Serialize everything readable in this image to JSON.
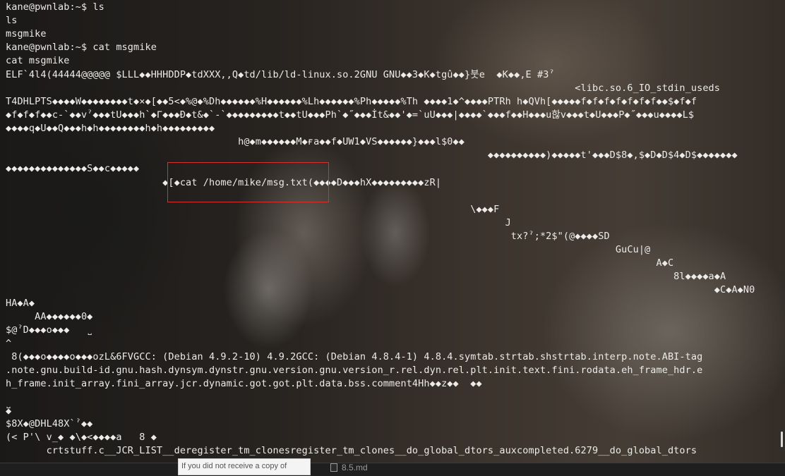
{
  "terminal": {
    "lines": [
      "kane@pwnlab:~$ ls",
      "ls",
      "msgmike",
      "kane@pwnlab:~$ cat msgmike",
      "cat msgmike",
      "ELF`4l4(44444@@@@@ $LLL◆◆HHHDDP◆tdXXX,,Q◆td/lib/ld-linux.so.2GNU GNU◆◆3◆K◆tgû◆◆}붓e  ◆K◆◆,E #3ˀ",
      "                                                                                                  <libc.so.6_IO_stdin_useds",
      "T4DHLPTS◆◆◆◆W◆◆◆◆◆◆◆◆t◆×◆[◆◆5<◆%@◆%Dh◆◆◆◆◆◆%H◆◆◆◆◆◆%Lh◆◆◆◆◆◆%Ph◆◆◆◆◆%Th ◆◆◆◆1◆^◆◆◆◆PTRh h◆QVh[◆◆◆◆◆f◆f◆f◆f◆f◆f◆f◆◆$◆f◆f",
      "◆f◆f◆f◆◆c-`◆◆vˀ◆◆◆tU◆◆◆h`◆Γ◆◆◆Đ◆t&◆`-`◆◆◆◆◆◆◆◆◆t◆◆tU◆◆◆Ph`◆˝◆◆◆İt&◆◆'◆=`uU◆◆◆|◆◆◆◆`◆◆◆f◆◆H◆◆◆u핞v◆◆◆t◆U◆◆◆P◆˝◆◆◆u◆◆◆◆L$",
      "◆◆◆◆q◆U◆◆Q◆◆◆h◆h◆◆◆◆◆◆◆◆h◆h◆◆◆◆◆◆◆◆◆",
      "                                        h@◆m◆◆◆◆◆◆M◆ғa◆◆f◆UW1◆VS◆◆◆◆◆◆}◆◆◆l$0◆◆",
      "                                                                                   ◆◆◆◆◆◆◆◆◆◆)◆◆◆◆◆t'◆◆◆D$8◆,$◆D◆D$4◆D$◆◆◆◆◆◆◆",
      "◆◆◆◆◆◆◆◆◆◆◆◆◆◆S◆◆c◆◆◆◆◆",
      "                           ◆[◆cat /home/mike/msg.txt(◆◆◆◆D◆◆◆hX◆◆◆◆◆◆◆◆◆zR|",
      "",
      "                                                                                \\◆◆◆F",
      "                                                                                      J",
      "                                                                                       tx?ˀ;*2$\"(@◆◆◆◆SD",
      "                                                                                                         GuCu|@",
      "                                                                                                                A◆C",
      "                                                                                                                   8l◆◆◆◆a◆A",
      "                                                                                                                          ◆C◆A◆N0",
      "HA◆A◆",
      "     AA◆◆◆◆◆◆0◆",
      "$@ˀD◆◆◆o◆◆◆   ˽",
      "^",
      " 8(◆◆◆o◆◆◆◆o◆◆◆ozL&6FVGCC: (Debian 4.9.2-10) 4.9.2GCC: (Debian 4.8.4-1) 4.8.4.symtab.strtab.shstrtab.interp.note.ABI-tag",
      ".note.gnu.build-id.gnu.hash.dynsym.dynstr.gnu.version.gnu.version_r.rel.dyn.rel.plt.init.text.fini.rodata.eh_frame_hdr.e",
      "h_frame.init_array.fini_array.jcr.dynamic.got.got.plt.data.bss.comment4Hh◆◆z◆◆  ◆◆",
      "",
      "˽",
      "◆",
      "$8X◆@DHL48X`ˀ◆◆",
      "(< P'\\ v_◆ ◆\\◆<◆◆◆◆a   8 ◆",
      "       crtstuff.c__JCR_LIST__deregister_tm_clonesregister_tm_clones__do_global_dtors_auxcompleted.6279__do_global_dtors"
    ]
  },
  "background_window": {
    "text": "If you did not receive a copy of",
    "file_label": "8.5.md"
  }
}
